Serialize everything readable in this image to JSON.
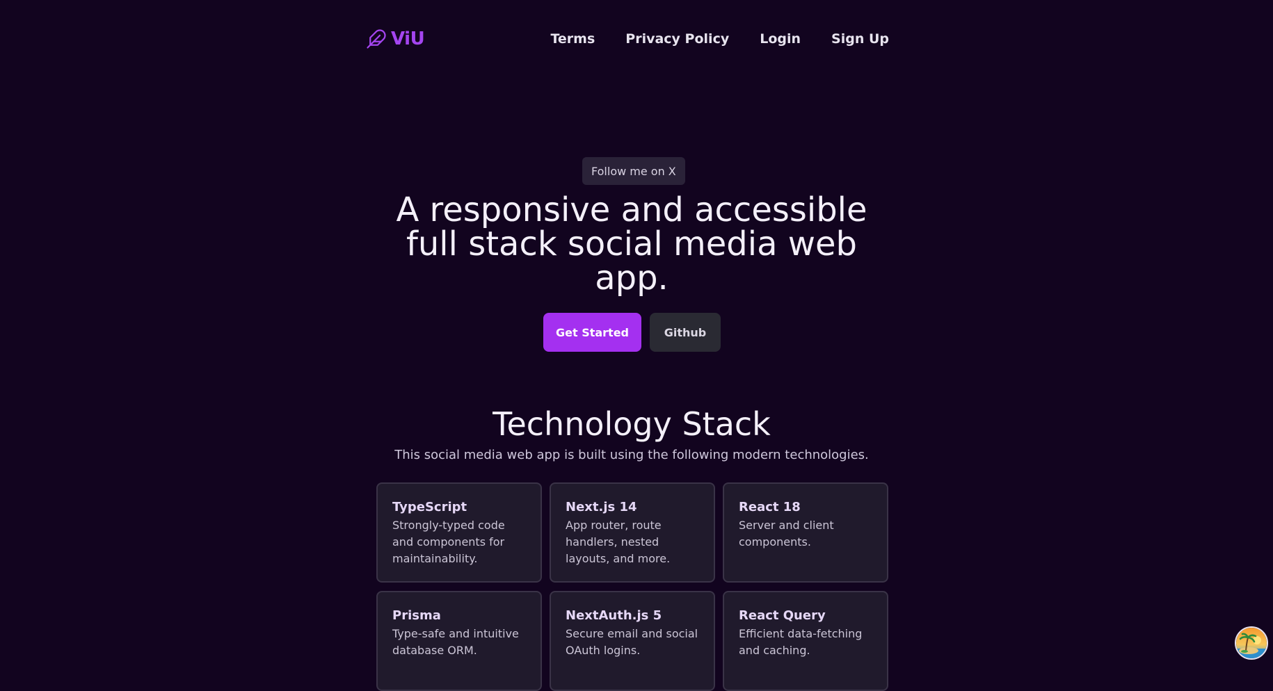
{
  "header": {
    "logo_text": "ViU",
    "logo_icon": "feather-icon",
    "nav": [
      {
        "label": "Terms"
      },
      {
        "label": "Privacy Policy"
      },
      {
        "label": "Login"
      },
      {
        "label": "Sign Up"
      }
    ]
  },
  "hero": {
    "pill_label": "Follow me on X",
    "title": "A responsive and accessible full stack social media web app.",
    "primary_button": "Get Started",
    "secondary_button": "Github"
  },
  "stack": {
    "title": "Technology Stack",
    "subtitle": "This social media web app is built using the following modern technologies.",
    "cards": [
      {
        "title": "TypeScript",
        "description": "Strongly-typed code and components for maintainability."
      },
      {
        "title": "Next.js 14",
        "description": "App router, route handlers, nested layouts, and more."
      },
      {
        "title": "React 18",
        "description": "Server and client components."
      },
      {
        "title": "Prisma",
        "description": "Type-safe and intuitive database ORM."
      },
      {
        "title": "NextAuth.js 5",
        "description": "Secure email and social OAuth logins."
      },
      {
        "title": "React Query",
        "description": "Efficient data-fetching and caching."
      }
    ]
  },
  "floating_avatar": {
    "icon": "island-avatar-icon"
  },
  "colors": {
    "background": "#12041f",
    "accent": "#a430f0",
    "card_bg": "#201a2c",
    "card_border": "#3a3347"
  }
}
